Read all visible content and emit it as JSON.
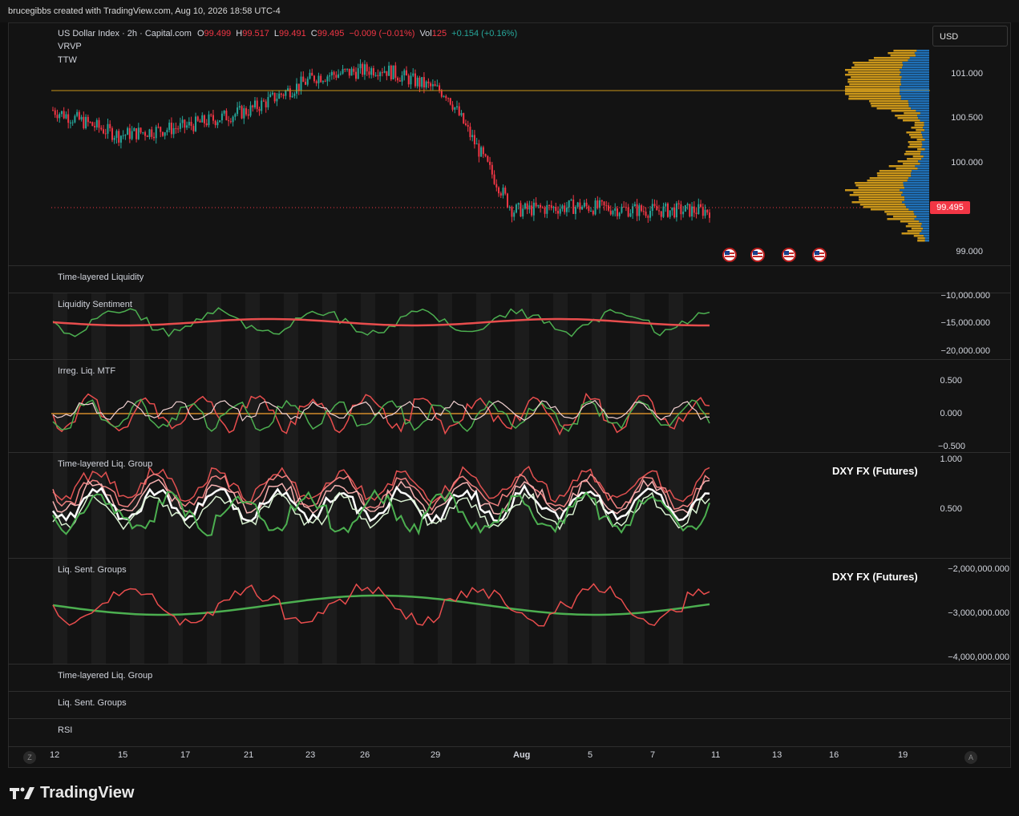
{
  "header": {
    "text": "brucegibbs created with TradingView.com, Aug 10, 2026 18:58 UTC-4"
  },
  "symbol": {
    "name": "US Dollar Index · 2h · Capital.com",
    "o_label": "O",
    "o_value": "99.499",
    "h_label": "H",
    "h_value": "99.517",
    "l_label": "L",
    "l_value": "99.491",
    "c_label": "C",
    "c_value": "99.495",
    "change": "−0.009 (−0.01%)",
    "vol_label": "Vol",
    "vol_value": "125",
    "vol_change": "+0.154 (+0.16%)"
  },
  "main_indicators": [
    "VRVP",
    "TTW"
  ],
  "currency": "USD",
  "price_axis": [
    "101.000",
    "100.500",
    "100.000",
    "99.000"
  ],
  "last_price": "99.495",
  "panes": {
    "tll": {
      "title": "Time-layered Liquidity"
    },
    "ls": {
      "title": "Liquidity Sentiment",
      "axis": [
        "−10,000.000",
        "−15,000.000",
        "−20,000.000"
      ]
    },
    "ilm": {
      "title": "Irreg. Liq. MTF",
      "axis": [
        "0.500",
        "0.000",
        "−0.500"
      ]
    },
    "tlg": {
      "title": "Time-layered Liq. Group",
      "axis": [
        "1.000",
        "0.500"
      ],
      "overlay": "DXY FX (Futures)"
    },
    "lsg": {
      "title": "Liq. Sent. Groups",
      "axis": [
        "−2,000,000.000",
        "−3,000,000.000",
        "−4,000,000.000"
      ],
      "overlay": "DXY FX (Futures)"
    },
    "collapsed": [
      "Time-layered Liq. Group",
      "Liq. Sent. Groups",
      "RSI"
    ]
  },
  "time_axis": [
    "12",
    "15",
    "17",
    "21",
    "23",
    "26",
    "29",
    "Aug",
    "5",
    "7",
    "11",
    "13",
    "16",
    "19"
  ],
  "axis_buttons": {
    "left": "Z",
    "right": "A"
  },
  "event_icons": [
    "us-flag-icon",
    "us-flag-icon",
    "us-flag-icon",
    "us-flag-icon"
  ],
  "colors": {
    "up": "#26a69a",
    "down": "#f23645",
    "red": "#e84d4d",
    "green": "#4caf50",
    "volume_up": "#c9951a",
    "volume_down": "#1f6fb5"
  },
  "brand": "TradingView",
  "chart_data": {
    "type": "line",
    "title": "US Dollar Index · 2h · Capital.com",
    "x": [
      "12",
      "15",
      "17",
      "21",
      "23",
      "26",
      "29",
      "Aug",
      "5",
      "7",
      "11"
    ],
    "series": [
      {
        "values": [
          100.7,
          100.4,
          100.5,
          100.7,
          101.1,
          101.2,
          100.9,
          99.5,
          99.55,
          99.5,
          99.5
        ]
      }
    ],
    "ylim": [
      98.95,
      101.25
    ]
  }
}
